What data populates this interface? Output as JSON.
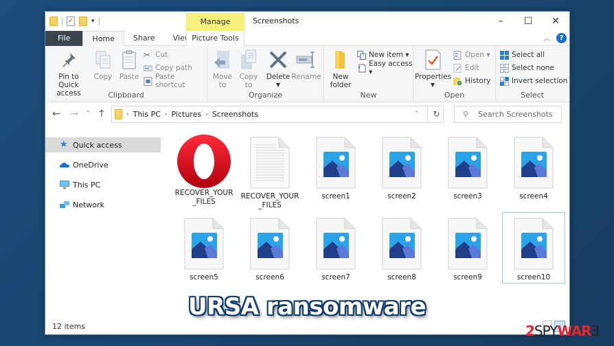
{
  "window": {
    "title": "Screenshots",
    "contextual_tab_header": "Manage",
    "controls": {
      "minimize": "–",
      "maximize": "☐",
      "close": "✕"
    }
  },
  "quick_access_toolbar": {
    "icons": [
      "folder-icon",
      "properties-icon",
      "new-folder-icon",
      "customize-dropdown-icon"
    ]
  },
  "ribbon_tabs": [
    {
      "label": "File",
      "active": false
    },
    {
      "label": "Home",
      "active": true
    },
    {
      "label": "Share",
      "active": false
    },
    {
      "label": "View",
      "active": false
    },
    {
      "label": "Picture Tools",
      "active": false
    }
  ],
  "ribbon": {
    "clipboard": {
      "label": "Clipboard",
      "pin": "Pin to Quick access",
      "pin_line1": "Pin to Quick",
      "pin_line2": "access",
      "copy": "Copy",
      "paste": "Paste",
      "cut": "Cut",
      "copy_path": "Copy path",
      "paste_shortcut": "Paste shortcut"
    },
    "organize": {
      "label": "Organize",
      "move_to": "Move",
      "move_to_2": "to",
      "copy_to": "Copy",
      "copy_to_2": "to",
      "delete": "Delete",
      "rename": "Rename"
    },
    "new": {
      "label": "New",
      "new_folder_1": "New",
      "new_folder_2": "folder",
      "new_item": "New item ▾",
      "easy_access": "Easy access ▾"
    },
    "open": {
      "label": "Open",
      "properties": "Properties",
      "open": "Open ▾",
      "edit": "Edit",
      "history": "History"
    },
    "select": {
      "label": "Select",
      "select_all": "Select all",
      "select_none": "Select none",
      "invert_selection": "Invert selection"
    }
  },
  "address_bar": {
    "breadcrumbs": [
      "This PC",
      "Pictures",
      "Screenshots"
    ],
    "search_placeholder": "Search Screenshots"
  },
  "nav_pane": {
    "items": [
      {
        "label": "Quick access",
        "icon": "star-icon",
        "selected": true
      },
      {
        "label": "OneDrive",
        "icon": "cloud-icon",
        "selected": false
      },
      {
        "label": "This PC",
        "icon": "monitor-icon",
        "selected": false
      },
      {
        "label": "Network",
        "icon": "network-icon",
        "selected": false
      }
    ]
  },
  "files": [
    {
      "name": "RECOVER_YOUR_FILES",
      "type": "opera-html"
    },
    {
      "name": "RECOVER_YOUR_FILES",
      "type": "text"
    },
    {
      "name": "screen1",
      "type": "image"
    },
    {
      "name": "screen2",
      "type": "image"
    },
    {
      "name": "screen3",
      "type": "image"
    },
    {
      "name": "screen4",
      "type": "image"
    },
    {
      "name": "screen5",
      "type": "image"
    },
    {
      "name": "screen6",
      "type": "image"
    },
    {
      "name": "screen7",
      "type": "image"
    },
    {
      "name": "screen8",
      "type": "image"
    },
    {
      "name": "screen9",
      "type": "image"
    },
    {
      "name": "screen10",
      "type": "image",
      "focused": true
    }
  ],
  "status_bar": {
    "item_count": "12 items"
  },
  "overlay": {
    "caption": "URSA ransomware",
    "watermark_2": "2",
    "watermark_spy": "SPY",
    "watermark_ware": "WAR",
    "watermark_e": "Ǝ"
  },
  "colors": {
    "manage_tab": "#f5ef7c",
    "file_tab": "#3b4451",
    "accent": "#1a6fc9",
    "desktop_bg": "#1a4670"
  }
}
